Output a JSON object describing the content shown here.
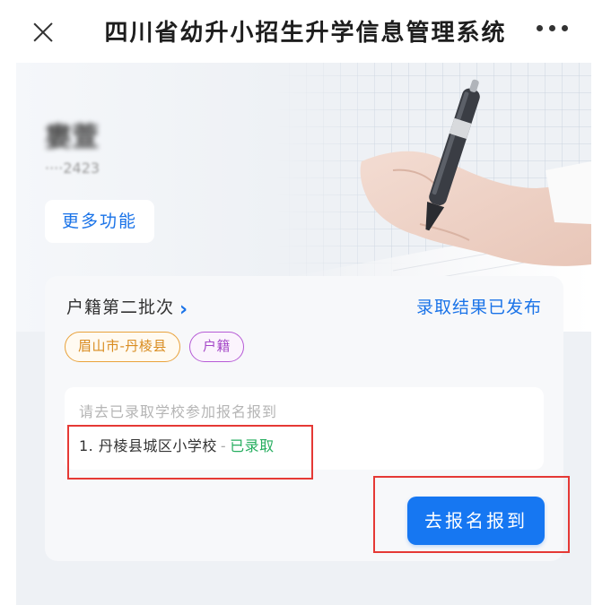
{
  "header": {
    "title": "四川省幼升小招生升学信息管理系统",
    "close_icon": "close-icon",
    "more_icon": "more-horizontal-icon"
  },
  "user": {
    "name": "婁萱",
    "id_suffix": "····2423"
  },
  "more_functions_label": "更多功能",
  "card": {
    "batch_label": "户籍第二批次",
    "batch_chevron": "›",
    "status": "录取结果已发布",
    "tags": [
      {
        "label": "眉山市-丹棱县",
        "color": "#e9a23b"
      },
      {
        "label": "户籍",
        "color": "#b65bd6"
      }
    ],
    "hint": "请去已录取学校参加报名报到",
    "schools": [
      {
        "index": "1.",
        "name": "丹棱县城区小学校",
        "separator": "-",
        "status": "已录取"
      }
    ],
    "action_label": "去报名报到"
  },
  "colors": {
    "accent": "#1677f2",
    "link": "#1a73e8",
    "admitted": "#27ae60",
    "highlight_box": "#e53935"
  }
}
